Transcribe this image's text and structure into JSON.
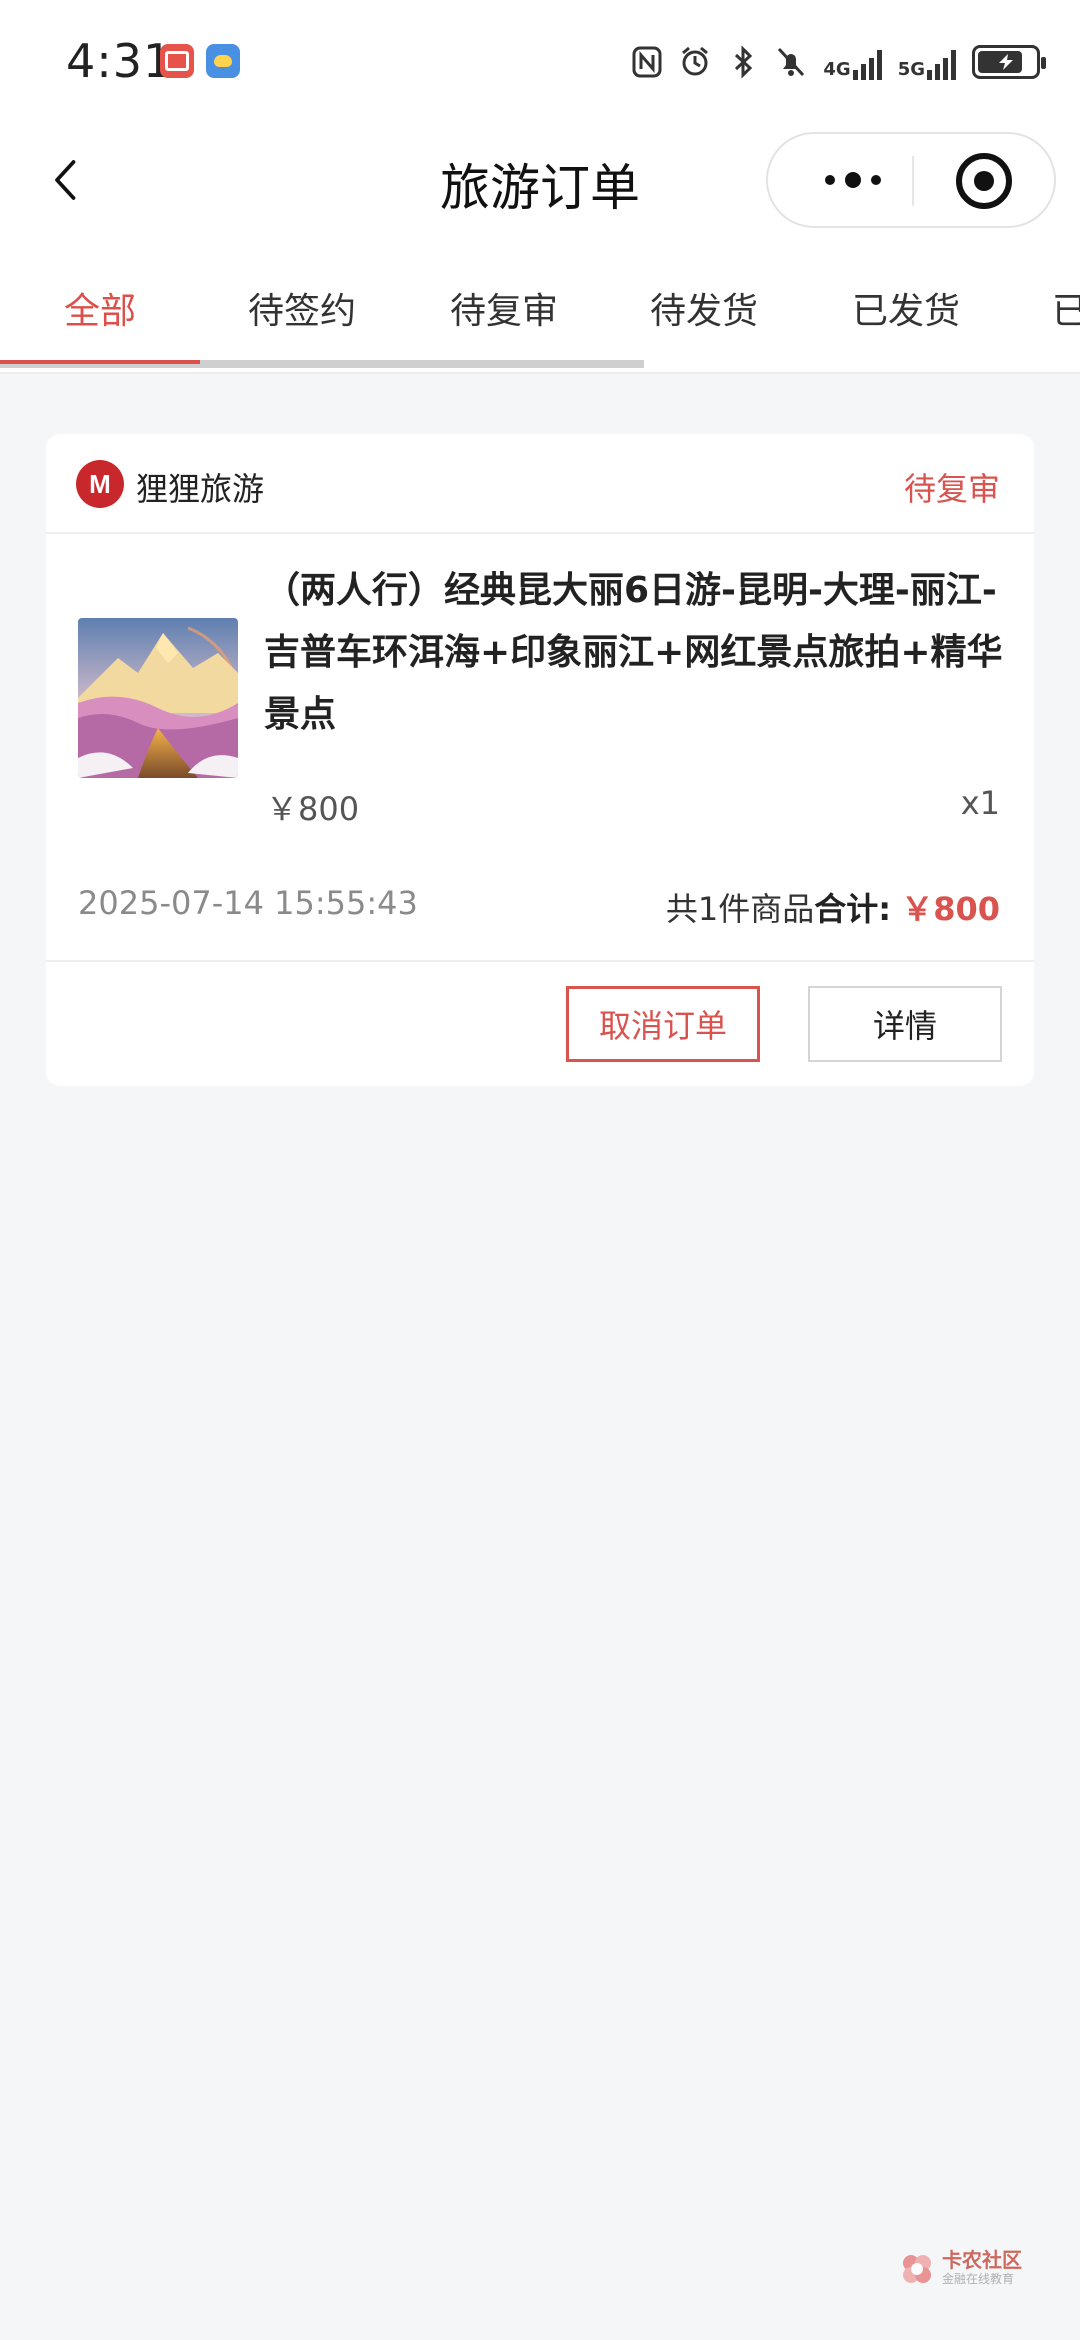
{
  "status_bar": {
    "time": "4:31",
    "network_1": "4G",
    "network_2": "5G"
  },
  "nav": {
    "title": "旅游订单"
  },
  "tabs": [
    {
      "label": "全部",
      "active": true
    },
    {
      "label": "待签约",
      "active": false
    },
    {
      "label": "待复审",
      "active": false
    },
    {
      "label": "待发货",
      "active": false
    },
    {
      "label": "已发货",
      "active": false
    },
    {
      "label": "已",
      "active": false
    }
  ],
  "order": {
    "store_name": "狸狸旅游",
    "status": "待复审",
    "product_title": "（两人行）经典昆大丽6日游-昆明-大理-丽江-吉普车环洱海+印象丽江+网红景点旅拍+精华景点",
    "price": "￥800",
    "quantity": "x1",
    "time": "2025-07-14 15:55:43",
    "item_count_text": "共1件商品",
    "total_label": "合计:",
    "total_value": "￥800",
    "cancel_label": "取消订单",
    "detail_label": "详情"
  },
  "watermark": {
    "text": "卡农社区",
    "sub": "金融在线教育"
  },
  "colors": {
    "accent": "#dc4f4a",
    "background": "#f5f6f8"
  }
}
